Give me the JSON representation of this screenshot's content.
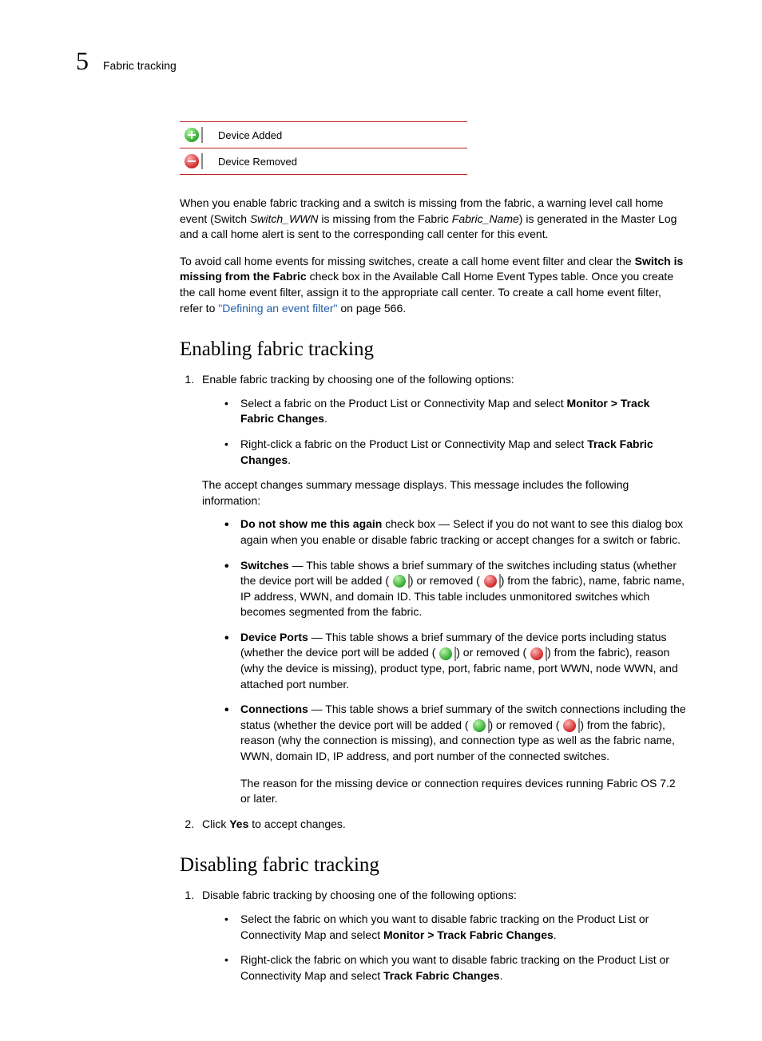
{
  "header": {
    "chapter_num": "5",
    "section": "Fabric tracking"
  },
  "icon_table": {
    "row1": "Device Added",
    "row2": "Device Removed"
  },
  "para1": {
    "t1": "When you enable fabric tracking and a switch is missing from the fabric, a warning level call home event (Switch ",
    "i1": "Switch_WWN",
    "t2": " is missing from the Fabric ",
    "i2": "Fabric_Name",
    "t3": ") is generated in the Master Log and a call home alert is sent to the corresponding call center for this event."
  },
  "para2": {
    "t1": "To avoid call home events for missing switches, create a call home event filter and clear the ",
    "b1": "Switch is missing from the Fabric",
    "t2": " check box in the Available Call Home Event Types table. Once you create the call home event filter, assign it to the appropriate call center. To create a call home event filter, refer to ",
    "link": "\"Defining an event filter\"",
    "t3": " on page 566."
  },
  "enabling": {
    "heading": "Enabling fabric tracking",
    "step1_intro": "Enable fabric tracking by choosing one of the following options:",
    "opt1": {
      "t1": "Select a fabric on the Product List or Connectivity Map and select ",
      "b1": "Monitor > Track Fabric Changes",
      "t2": "."
    },
    "opt2": {
      "t1": "Right-click a fabric on the Product List or Connectivity Map and select ",
      "b1": "Track Fabric Changes",
      "t2": "."
    },
    "accept": "The accept changes summary message displays. This message includes the following information:",
    "b1": {
      "lead": "Do not show me this again",
      "rest": " check box — Select if you do not want to see this dialog box again when you enable or disable fabric tracking or accept changes for a switch or fabric."
    },
    "b2": {
      "lead": "Switches",
      "t1": " — This table shows a brief summary of the switches including status (whether the device port will be added ( ",
      "t2": ") or removed ( ",
      "t3": ") from the fabric), name, fabric name, IP address, WWN, and domain ID. This table includes unmonitored switches which becomes segmented from the fabric."
    },
    "b3": {
      "lead": "Device Ports",
      "t1": " — This table shows a brief summary of the device ports including status (whether the device port will be added ( ",
      "t2": ") or removed ( ",
      "t3": ") from the fabric), reason (why the device is missing), product type, port, fabric name, port WWN, node WWN, and attached port number."
    },
    "b4": {
      "lead": "Connections",
      "t1": " — This table shows a brief summary of the switch connections including the status (whether the device port will be added ( ",
      "t2": ") or removed ( ",
      "t3": ") from the fabric), reason (why the connection is missing), and connection type as well as the fabric name, WWN, domain ID, IP address, and port number of the connected switches."
    },
    "reason_note": "The reason for the missing device or connection requires devices running Fabric OS 7.2 or later.",
    "step2": {
      "t1": "Click ",
      "b1": "Yes",
      "t2": " to accept changes."
    }
  },
  "disabling": {
    "heading": "Disabling fabric tracking",
    "step1_intro": "Disable fabric tracking by choosing one of the following options:",
    "opt1": {
      "t1": "Select the fabric on which you want to disable fabric tracking on the Product List or Connectivity Map and select ",
      "b1": "Monitor > Track Fabric Changes",
      "t2": "."
    },
    "opt2": {
      "t1": "Right-click the fabric on which you want to disable fabric tracking on the Product List or Connectivity Map and select ",
      "b1": "Track Fabric Changes",
      "t2": "."
    }
  }
}
